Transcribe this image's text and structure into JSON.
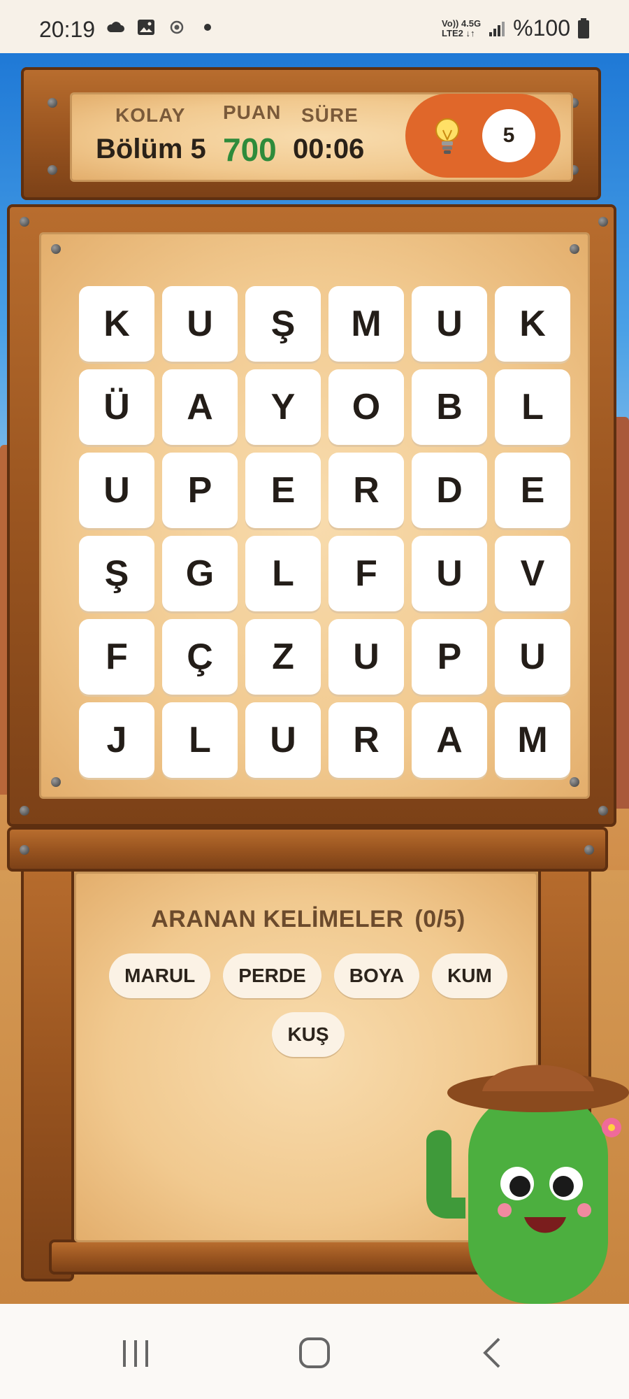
{
  "status_bar": {
    "time": "20:19",
    "network_line1": "Vo)) 4.5G",
    "network_line2": "LTE2 ↓↑",
    "battery": "%100",
    "icons": [
      "cloud-icon",
      "gallery-icon",
      "location-icon",
      "dot-icon",
      "signal-icon",
      "battery-icon"
    ]
  },
  "header": {
    "difficulty_label": "KOLAY",
    "level_value": "Bölüm 5",
    "score_label": "PUAN",
    "score_value": "700",
    "time_label": "SÜRE",
    "time_value": "00:06",
    "hint_count": "5",
    "hint_icon": "lightbulb-icon"
  },
  "grid": {
    "rows": [
      [
        "K",
        "U",
        "Ş",
        "M",
        "U",
        "K"
      ],
      [
        "Ü",
        "A",
        "Y",
        "O",
        "B",
        "L"
      ],
      [
        "U",
        "P",
        "E",
        "R",
        "D",
        "E"
      ],
      [
        "Ş",
        "G",
        "L",
        "F",
        "U",
        "V"
      ],
      [
        "F",
        "Ç",
        "Z",
        "U",
        "P",
        "U"
      ],
      [
        "J",
        "L",
        "U",
        "R",
        "A",
        "M"
      ]
    ]
  },
  "words_panel": {
    "title": "ARANAN KELİMELER",
    "count": "(0/5)",
    "words": [
      "MARUL",
      "PERDE",
      "BOYA",
      "KUM",
      "KUŞ"
    ]
  },
  "colors": {
    "score_green": "#2e8b3b",
    "hint_orange": "#e0672a",
    "wood": "#9a5520",
    "parchment": "#f1c98f"
  },
  "nav_bar": {
    "icons": [
      "recent-apps-icon",
      "home-icon",
      "back-icon"
    ]
  }
}
